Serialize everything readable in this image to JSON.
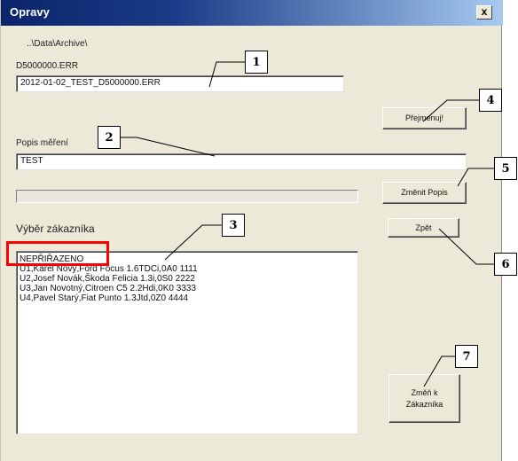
{
  "window": {
    "title": "Opravy",
    "close_label": "x"
  },
  "path_label": "..\\Data\\Archive\\",
  "file_label": "D5000000.ERR",
  "file_input_value": "2012-01-02_TEST_D5000000.ERR",
  "rename_button": "Přejmenuj!",
  "description_label": "Popis měření",
  "description_input_value": "TEST",
  "progress_value": 0,
  "change_description_button": "Změnit Popis",
  "customer_select_label": "Výběr zákazníka",
  "back_button": "Zpět",
  "customer_list": [
    "NEPŘIŘAZENO",
    "U1,Karel Nový,Ford Focus 1.6TDCi,0A0 1111",
    "U2,Josef Novák,Škoda Felicia 1.3i,0S0 2222",
    "U3,Jan Novotný,Citroen C5 2.2Hdi,0K0 3333",
    "U4,Pavel Starý,Fiat Punto 1.3Jtd,0Z0 4444"
  ],
  "change_customer_button": [
    "Změň k",
    "Zákazníka"
  ],
  "callouts": [
    "1",
    "2",
    "3",
    "4",
    "5",
    "6",
    "7"
  ]
}
